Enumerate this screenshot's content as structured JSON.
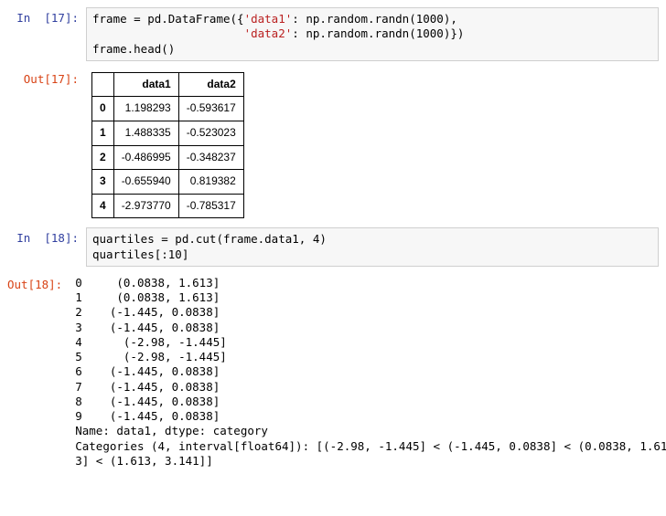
{
  "cells": {
    "c17": {
      "in_prompt": "In  [17]:",
      "out_prompt": "Out[17]:",
      "code_prefix": "frame = pd.DataFrame({",
      "str1": "'data1'",
      "mid1": ": np.random.randn(1000),",
      "indent": "                      ",
      "str2": "'data2'",
      "mid2": ": np.random.randn(1000)})",
      "line2": "frame.head()",
      "table": {
        "cols": [
          "data1",
          "data2"
        ],
        "rows": [
          {
            "idx": "0",
            "v1": "1.198293",
            "v2": "-0.593617"
          },
          {
            "idx": "1",
            "v1": "1.488335",
            "v2": "-0.523023"
          },
          {
            "idx": "2",
            "v1": "-0.486995",
            "v2": "-0.348237"
          },
          {
            "idx": "3",
            "v1": "-0.655940",
            "v2": "0.819382"
          },
          {
            "idx": "4",
            "v1": "-2.973770",
            "v2": "-0.785317"
          }
        ]
      }
    },
    "c18": {
      "in_prompt": "In  [18]:",
      "out_prompt": "Out[18]:",
      "code_line1": "quartiles = pd.cut(frame.data1, 4)",
      "code_line2": "quartiles[:10]",
      "output": "0     (0.0838, 1.613]\n1     (0.0838, 1.613]\n2    (-1.445, 0.0838]\n3    (-1.445, 0.0838]\n4      (-2.98, -1.445]\n5      (-2.98, -1.445]\n6    (-1.445, 0.0838]\n7    (-1.445, 0.0838]\n8    (-1.445, 0.0838]\n9    (-1.445, 0.0838]\nName: data1, dtype: category\nCategories (4, interval[float64]): [(-2.98, -1.445] < (-1.445, 0.0838] < (0.0838, 1.61\n3] < (1.613, 3.141]]"
    }
  }
}
